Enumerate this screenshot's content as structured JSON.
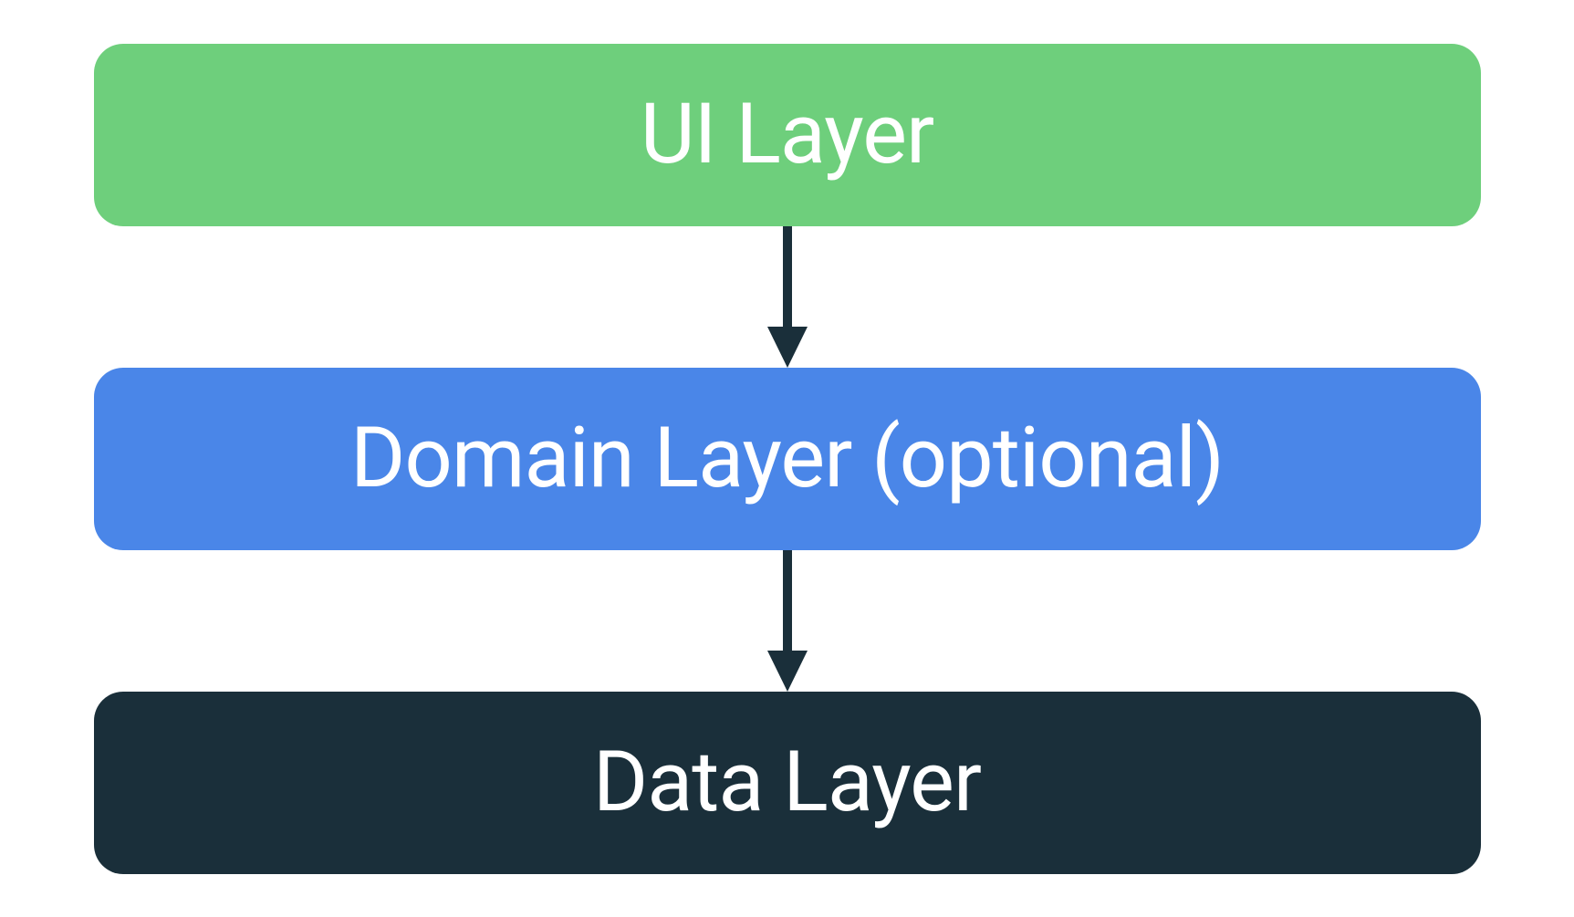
{
  "layers": {
    "ui": {
      "label": "UI Layer",
      "color": "#6ecf7c"
    },
    "domain": {
      "label": "Domain Layer (optional)",
      "color": "#4a86e8"
    },
    "data": {
      "label": "Data Layer",
      "color": "#1a2f3a"
    }
  },
  "arrow_color": "#1a2f3a"
}
